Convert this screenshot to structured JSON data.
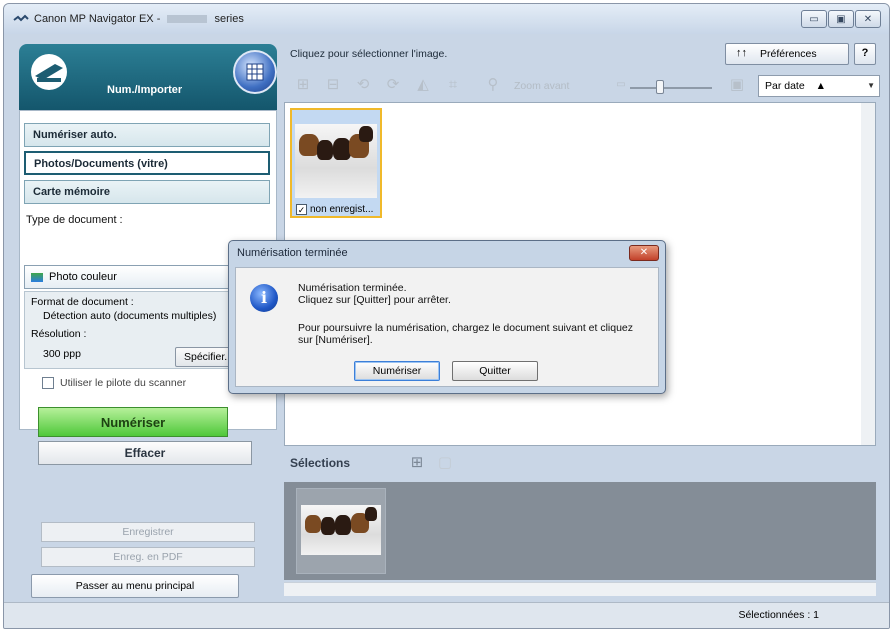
{
  "window": {
    "title_prefix": "Canon MP Navigator EX -",
    "title_suffix": "series",
    "controls": {
      "minimize": "▭",
      "maximize": "▣",
      "close": "✕"
    }
  },
  "left": {
    "header_label": "Num./Importer",
    "modes": [
      "Numériser auto.",
      "Photos/Documents (vitre)",
      "Carte mémoire"
    ],
    "active_mode": "Photos/Documents (vitre)",
    "doc_type_label": "Type de document :",
    "doc_type_value": "Photo couleur",
    "format_label": "Format de document :",
    "format_value": "Détection auto (documents multiples)",
    "resolution_label": "Résolution :",
    "resolution_value": "300 ppp",
    "specify_button": "Spécifier...",
    "driver_checkbox_label": "Utiliser le pilote du scanner",
    "driver_checkbox_checked": false,
    "scan_button": "Numériser",
    "clear_button": "Effacer",
    "save_button": "Enregistrer",
    "save_pdf_button": "Enreg. en PDF",
    "main_menu_button": "Passer au menu principal"
  },
  "right": {
    "hint": "Cliquez pour sélectionner l'image.",
    "preferences_button": "Préférences",
    "help_button": "?",
    "zoom_label": "Zoom avant",
    "sort_value": "Par date",
    "sort_arrow": "▲",
    "thumbnail_label": "non enregist...",
    "thumbnail_checked": true,
    "selections_title": "Sélections",
    "status": "Sélectionnées : 1"
  },
  "dialog": {
    "title": "Numérisation terminée",
    "line1": "Numérisation terminée.",
    "line2": "Cliquez sur [Quitter] pour arrêter.",
    "line3": "Pour poursuivre la numérisation, chargez le document suivant et cliquez",
    "line4": "sur [Numériser].",
    "scan_button": "Numériser",
    "quit_button": "Quitter"
  },
  "colors": {
    "banner": "#1d6a80",
    "scan_button": "#4fc83a",
    "selection_border": "#f0b92a"
  }
}
